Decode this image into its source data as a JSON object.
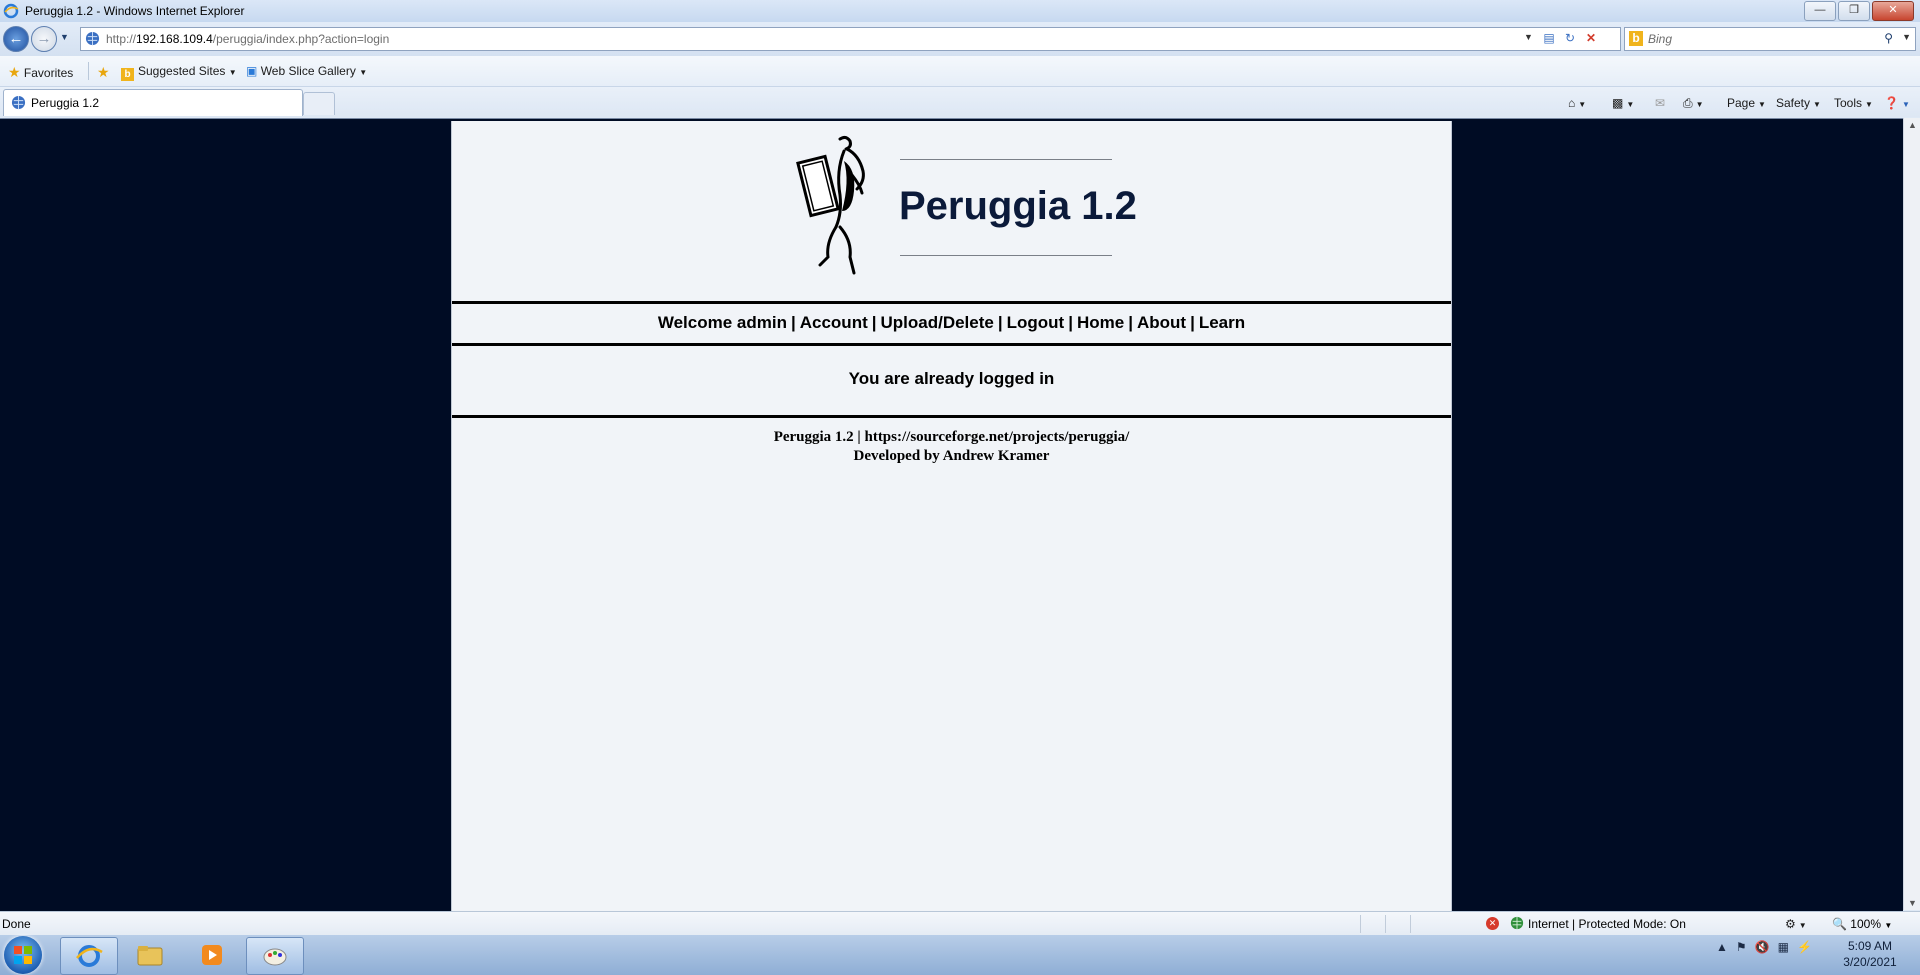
{
  "window": {
    "title": "Peruggia 1.2 - Windows Internet Explorer",
    "controls": [
      "minimize",
      "restore",
      "close"
    ]
  },
  "addressbar": {
    "url_prefix": "http://",
    "url_host": "192.168.109.4",
    "url_path": "/peruggia/index.php?action=login",
    "search_placeholder": "Bing"
  },
  "favorites_bar": {
    "favorites_label": "Favorites",
    "items": [
      {
        "label": "Suggested Sites"
      },
      {
        "label": "Web Slice Gallery"
      }
    ]
  },
  "tabs": [
    {
      "label": "Peruggia 1.2"
    }
  ],
  "command_bar": {
    "page_label": "Page",
    "safety_label": "Safety",
    "tools_label": "Tools"
  },
  "site": {
    "title": "Peruggia 1.2",
    "nav": [
      {
        "label": "Welcome admin",
        "link": false
      },
      {
        "label": "Account",
        "link": true
      },
      {
        "label": "Upload/Delete",
        "link": true
      },
      {
        "label": "Logout",
        "link": true
      },
      {
        "label": "Home",
        "link": true
      },
      {
        "label": "About",
        "link": true
      },
      {
        "label": "Learn",
        "link": true
      }
    ],
    "message": "You are already logged in",
    "footer_line1": "Peruggia 1.2 | https://sourceforge.net/projects/peruggia/",
    "footer_line2": "Developed by Andrew Kramer"
  },
  "statusbar": {
    "status": "Done",
    "zone": "Internet | Protected Mode: On",
    "zoom": "100%"
  },
  "taskbar": {
    "apps": [
      "internet-explorer",
      "windows-explorer",
      "media-player",
      "paint"
    ],
    "time": "5:09 AM",
    "date": "3/20/2021"
  },
  "colors": {
    "page_background": "#000c24",
    "content_background": "#f1f4f8",
    "title_color": "#0b1a3a"
  }
}
